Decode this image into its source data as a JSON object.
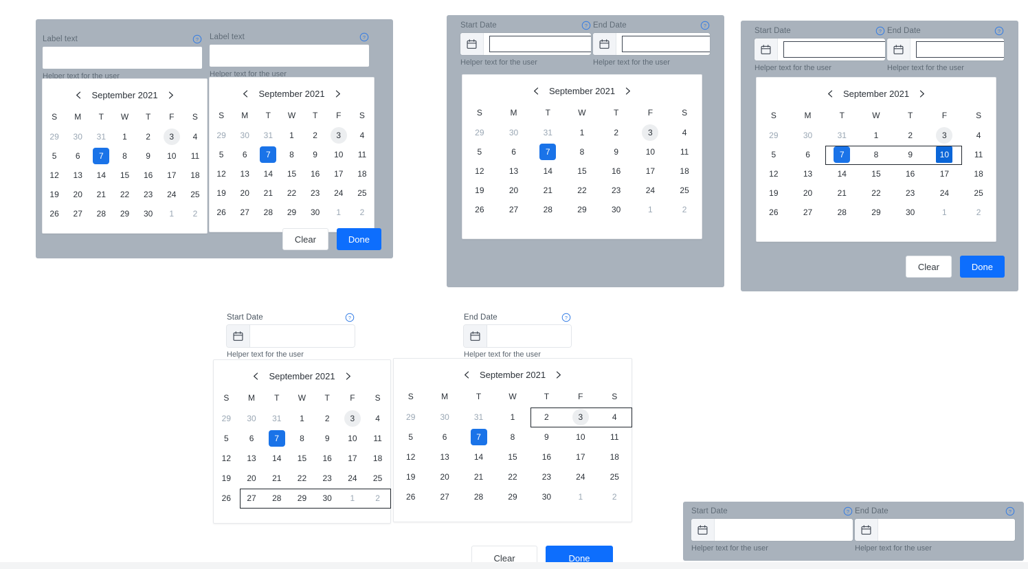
{
  "common": {
    "month_title": "September 2021",
    "weekdays": [
      "S",
      "M",
      "T",
      "W",
      "T",
      "F",
      "S"
    ],
    "helper_text": "Helper text for the user",
    "label_text": "Label text",
    "start_date_label": "Start Date",
    "end_date_label": "End Date",
    "clear_label": "Clear",
    "done_label": "Done",
    "input_value": "",
    "prev_icon": "chevron-left-icon",
    "next_icon": "chevron-right-icon",
    "help_icon": "help-circle-icon",
    "calendar_icon": "calendar-icon",
    "accent_blue": "#1a73e8",
    "button_blue": "#0d6efd",
    "panel_gray": "#a9b2bc",
    "today_gray": "#eceef0",
    "muted_day": "#9aa7b4"
  },
  "calendar_weeks": [
    [
      "29",
      "30",
      "31",
      "1",
      "2",
      "3",
      "4"
    ],
    [
      "5",
      "6",
      "7",
      "8",
      "9",
      "10",
      "11"
    ],
    [
      "12",
      "13",
      "14",
      "15",
      "16",
      "17",
      "18"
    ],
    [
      "19",
      "20",
      "21",
      "22",
      "23",
      "24",
      "25"
    ],
    [
      "26",
      "27",
      "28",
      "29",
      "30",
      "1",
      "2"
    ]
  ],
  "panel1": {
    "name": "dual-single-date-picker-panel",
    "left": {
      "label": "Label text",
      "helper": "Helper text for the user",
      "value": ""
    },
    "right": {
      "label": "Label text",
      "helper": "Helper text for the user",
      "value": ""
    },
    "selected_day": "7",
    "today_day": "3",
    "clear_label": "Clear",
    "done_label": "Done"
  },
  "panel2": {
    "name": "range-picker-single-calendar-panel",
    "start": {
      "label": "Start Date",
      "helper": "Helper text for the user",
      "value": ""
    },
    "end": {
      "label": "End Date",
      "helper": "Helper text for the user",
      "value": ""
    },
    "selected_day": "7",
    "today_day": "3"
  },
  "panel3": {
    "name": "range-picker-with-selection-panel",
    "start": {
      "label": "Start Date",
      "helper": "Helper text for the user",
      "value": ""
    },
    "end": {
      "label": "End Date",
      "helper": "Helper text for the user",
      "value": ""
    },
    "range_start_day": "7",
    "range_end_day": "10",
    "today_day": "3",
    "clear_label": "Clear",
    "done_label": "Done"
  },
  "panel4": {
    "name": "dual-calendar-range-picker-light",
    "start": {
      "label": "Start Date",
      "helper": "Helper text for the user",
      "value": ""
    },
    "end": {
      "label": "End Date",
      "helper": "Helper text for the user",
      "value": ""
    },
    "left_selected_day": "7",
    "left_today_day": "3",
    "left_focus_row_from": "27",
    "left_focus_row_to": "2",
    "right_selected_day": "7",
    "right_today_day": "3",
    "right_focus_from": "2",
    "right_focus_to": "4",
    "clear_label": "Clear",
    "done_label": "Done"
  },
  "panel5": {
    "name": "range-inputs-only-panel",
    "start": {
      "label": "Start Date",
      "helper": "Helper text for the user",
      "value": ""
    },
    "end": {
      "label": "End Date",
      "helper": "Helper text for the user",
      "value": ""
    }
  }
}
